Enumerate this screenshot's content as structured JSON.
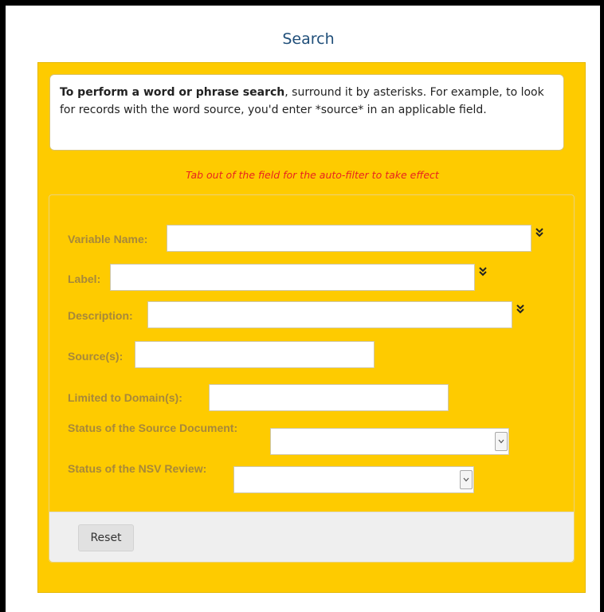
{
  "page": {
    "title": "Search"
  },
  "info": {
    "bold": "To perform a word or phrase search",
    "rest": ", surround it by asterisks. For example, to look for records with the word source, you'd enter *source* in an applicable field."
  },
  "hint": "Tab out of the field for the auto-filter to take effect",
  "fields": {
    "variable_name": {
      "label": "Variable Name:",
      "value": ""
    },
    "label": {
      "label": "Label:",
      "value": ""
    },
    "description": {
      "label": "Description:",
      "value": ""
    },
    "sources": {
      "label": "Source(s):",
      "value": ""
    },
    "domains": {
      "label": "Limited to Domain(s):",
      "value": ""
    },
    "status_source_document": {
      "label": "Status of the Source Document:",
      "value": ""
    },
    "status_nsv_review": {
      "label": "Status of the NSV Review:",
      "value": ""
    }
  },
  "footer": {
    "reset_label": "Reset"
  },
  "icons": {
    "expand": "double-chevron-down-icon",
    "select_arrow": "chevron-down-icon"
  },
  "colors": {
    "panel_bg": "#fecb00",
    "label_text": "#a7883a",
    "hint_text": "#e8231f",
    "title_text": "#1f4e79"
  }
}
